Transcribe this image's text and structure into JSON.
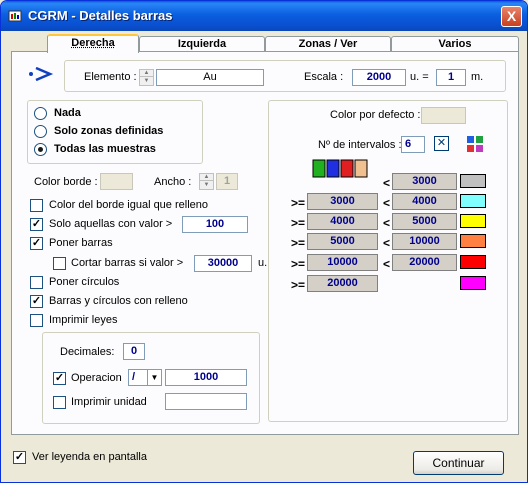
{
  "window": {
    "title": "CGRM - Detalles barras",
    "close_label": "X"
  },
  "tabs": [
    {
      "label": "Derecha",
      "active": true
    },
    {
      "label": "Izquierda",
      "active": false
    },
    {
      "label": "Zonas / Ver",
      "active": false
    },
    {
      "label": "Varios",
      "active": false
    }
  ],
  "header": {
    "elemento_label": "Elemento :",
    "elemento_value": "Au",
    "escala_label": "Escala :",
    "escala_value": "2000",
    "u_equals": "u. =",
    "m_value": "1",
    "m_unit": "m."
  },
  "mode_radios": [
    {
      "label": "Nada",
      "selected": false
    },
    {
      "label": "Solo zonas definidas",
      "selected": false
    },
    {
      "label": "Todas las muestras",
      "selected": true
    }
  ],
  "border": {
    "color_label": "Color borde :",
    "ancho_label": "Ancho :",
    "ancho_value": "1"
  },
  "options": {
    "color_igual": {
      "label": "Color del borde igual que relleno",
      "checked": false
    },
    "solo_aquellas": {
      "label": "Solo aquellas con valor >",
      "checked": true,
      "value": "100"
    },
    "poner_barras": {
      "label": "Poner barras",
      "checked": true
    },
    "cortar_barras": {
      "label": "Cortar barras si valor >",
      "checked": false,
      "value": "30000",
      "unit": "u."
    },
    "poner_circulos": {
      "label": "Poner círculos",
      "checked": false
    },
    "barras_circulos": {
      "label": "Barras y círculos con relleno",
      "checked": true
    },
    "imprimir_leyes": {
      "label": "Imprimir leyes",
      "checked": false
    }
  },
  "format": {
    "decimales_label": "Decimales:",
    "decimales_value": "0",
    "operacion_label": "Operacion",
    "operacion_checked": true,
    "operacion_operator": "/",
    "operacion_value": "1000",
    "imprimir_unidad_label": "Imprimir unidad",
    "imprimir_unidad_checked": false,
    "imprimir_unidad_value": ""
  },
  "colors": {
    "color_defecto_label": "Color por defecto :",
    "intervalos_label": "Nº de intervalos :",
    "intervalos_value": "6",
    "intervals": [
      {
        "prefix": "",
        "from": "",
        "to_sym": "<",
        "to": "3000",
        "color": "#c0c0c0"
      },
      {
        "prefix": ">=",
        "from": "3000",
        "to_sym": "<",
        "to": "4000",
        "color": "#80ffff"
      },
      {
        "prefix": ">=",
        "from": "4000",
        "to_sym": "<",
        "to": "5000",
        "color": "#ffff00"
      },
      {
        "prefix": ">=",
        "from": "5000",
        "to_sym": "<",
        "to": "10000",
        "color": "#ff8040"
      },
      {
        "prefix": ">=",
        "from": "10000",
        "to_sym": "<",
        "to": "20000",
        "color": "#ff0000"
      },
      {
        "prefix": ">=",
        "from": "20000",
        "to_sym": "",
        "to": "",
        "color": "#ff00ff"
      }
    ]
  },
  "footer": {
    "ver_leyenda_label": "Ver leyenda en pantalla",
    "ver_leyenda_checked": true,
    "continuar_label": "Continuar"
  }
}
